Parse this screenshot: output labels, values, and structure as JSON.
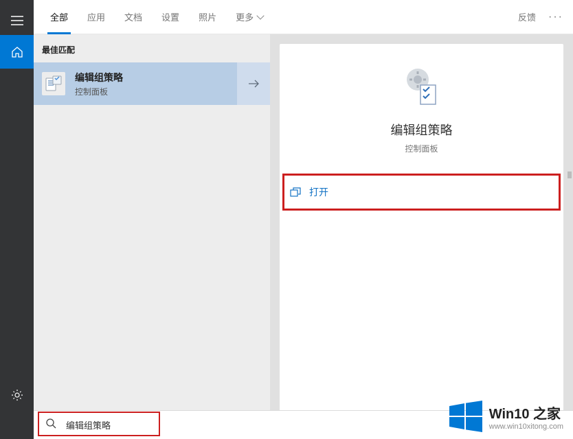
{
  "sidebar": {
    "hamburger": "hamburger",
    "home": "home",
    "settings": "settings"
  },
  "tabs": {
    "items": [
      {
        "label": "全部",
        "active": true
      },
      {
        "label": "应用",
        "active": false
      },
      {
        "label": "文档",
        "active": false
      },
      {
        "label": "设置",
        "active": false
      },
      {
        "label": "照片",
        "active": false
      }
    ],
    "more": "更多",
    "feedback": "反馈"
  },
  "results": {
    "section_label": "最佳匹配",
    "best": {
      "name": "编辑组策略",
      "sub": "控制面板"
    }
  },
  "detail": {
    "title": "编辑组策略",
    "sub": "控制面板",
    "open_label": "打开"
  },
  "search": {
    "value": "编辑组策略"
  },
  "watermark": {
    "title": "Win10 之家",
    "url": "www.win10xitong.com"
  }
}
